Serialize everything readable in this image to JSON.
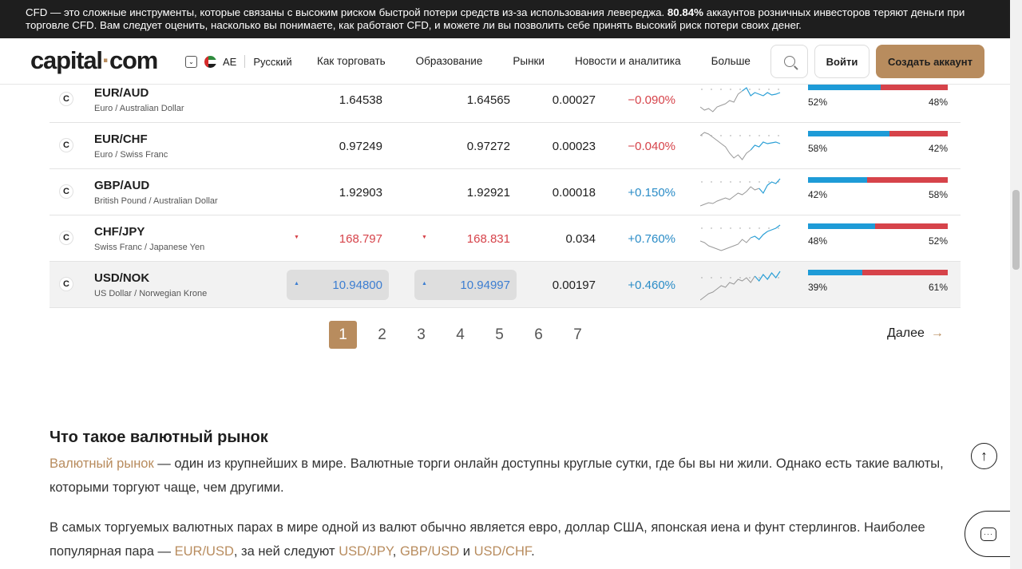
{
  "risk_banner": {
    "text_before": "CFD — это сложные инструменты, которые связаны с высоким риском быстрой потери средств из-за использования левереджа. ",
    "percent": "80.84%",
    "text_after": " аккаунтов розничных инвесторов теряют деньги при торговле CFD. Вам следует оценить, насколько вы понимаете, как работают CFD, и можете ли вы позволить себе принять высокий риск потери своих денег."
  },
  "header": {
    "logo_main": "capital",
    "logo_dot": "·",
    "logo_tail": "com",
    "region_code": "AE",
    "language": "Русский",
    "nav": [
      "Как торговать",
      "Образование",
      "Рынки",
      "Новости и аналитика",
      "Больше"
    ],
    "login": "Войти",
    "create_account": "Создать аккаунт"
  },
  "rows": [
    {
      "symbol": "EUR/AUD",
      "name": "Euro / Australian Dollar",
      "sell": "1.64538",
      "buy": "1.64565",
      "spread": "0.00027",
      "change": "−0.090%",
      "change_dir": "neg",
      "tick": "",
      "buyers_pct": 52,
      "left_label": "52%",
      "right_label": "48%",
      "highlight": false,
      "spark": [
        30,
        34,
        32,
        36,
        30,
        28,
        26,
        22,
        24,
        14,
        10,
        6,
        16,
        12,
        14,
        16,
        12,
        15,
        14,
        12
      ],
      "spark_split": 10
    },
    {
      "symbol": "EUR/CHF",
      "name": "Euro / Swiss Franc",
      "sell": "0.97249",
      "buy": "0.97272",
      "spread": "0.00023",
      "change": "−0.040%",
      "change_dir": "neg",
      "tick": "",
      "buyers_pct": 58,
      "left_label": "58%",
      "right_label": "42%",
      "highlight": false,
      "spark": [
        8,
        4,
        6,
        10,
        14,
        18,
        22,
        30,
        36,
        32,
        38,
        30,
        26,
        20,
        22,
        16,
        18,
        17,
        16,
        18
      ],
      "spark_split": 12
    },
    {
      "symbol": "GBP/AUD",
      "name": "British Pound / Australian Dollar",
      "sell": "1.92903",
      "buy": "1.92921",
      "spread": "0.00018",
      "change": "+0.150%",
      "change_dir": "pos",
      "tick": "",
      "buyers_pct": 42,
      "left_label": "42%",
      "right_label": "58%",
      "highlight": false,
      "spark": [
        38,
        36,
        34,
        35,
        32,
        30,
        28,
        30,
        26,
        22,
        24,
        20,
        14,
        18,
        16,
        22,
        12,
        8,
        10,
        4
      ],
      "spark_split": 14
    },
    {
      "symbol": "CHF/JPY",
      "name": "Swiss Franc / Japanese Yen",
      "sell": "168.797",
      "buy": "168.831",
      "spread": "0.034",
      "change": "+0.760%",
      "change_dir": "pos",
      "tick": "down",
      "buyers_pct": 48,
      "left_label": "48%",
      "right_label": "52%",
      "highlight": false,
      "spark": [
        24,
        26,
        30,
        32,
        34,
        36,
        34,
        32,
        30,
        28,
        22,
        26,
        20,
        18,
        22,
        16,
        12,
        10,
        8,
        4
      ],
      "spark_split": 12
    },
    {
      "symbol": "USD/NOK",
      "name": "US Dollar / Norwegian Krone",
      "sell": "10.94800",
      "buy": "10.94997",
      "spread": "0.00197",
      "change": "+0.460%",
      "change_dir": "pos",
      "tick": "up",
      "buyers_pct": 39,
      "left_label": "39%",
      "right_label": "61%",
      "highlight": true,
      "spark": [
        40,
        36,
        32,
        30,
        26,
        22,
        24,
        18,
        20,
        14,
        16,
        12,
        18,
        10,
        16,
        8,
        14,
        6,
        12,
        4
      ],
      "spark_split": 13
    }
  ],
  "pagination": {
    "pages": [
      "1",
      "2",
      "3",
      "4",
      "5",
      "6",
      "7"
    ],
    "active": "1",
    "next": "Далее"
  },
  "article": {
    "heading": "Что такое валютный рынок",
    "p1_link": "Валютный рынок",
    "p1_text": " — один из крупнейших в мире. Валютные торги онлайн доступны круглые сутки, где бы вы ни жили. Однако есть такие валюты, которыми торгуют чаще, чем другими.",
    "p2_text": "В самых торгуемых валютных парах в мире одной из валют обычно является евро, доллар США, японская иена и фунт стерлингов. Наиболее популярная пара — ",
    "p2_link1": "EUR/USD",
    "p2_mid": ", за ней следуют ",
    "p2_link2": "USD/JPY",
    "p2_comma": ", ",
    "p2_link3": "GBP/USD",
    "p2_and": " и ",
    "p2_link4": "USD/CHF",
    "p2_end": "."
  },
  "colors": {
    "accent": "#b88c5e",
    "buy_blue": "#1e9bd7",
    "sell_red": "#d6434a",
    "positive": "#2a8cc7",
    "negative": "#d6434a"
  },
  "icons": {
    "scroll_top": "arrow-up-icon",
    "chat": "chat-icon",
    "search": "search-icon"
  }
}
